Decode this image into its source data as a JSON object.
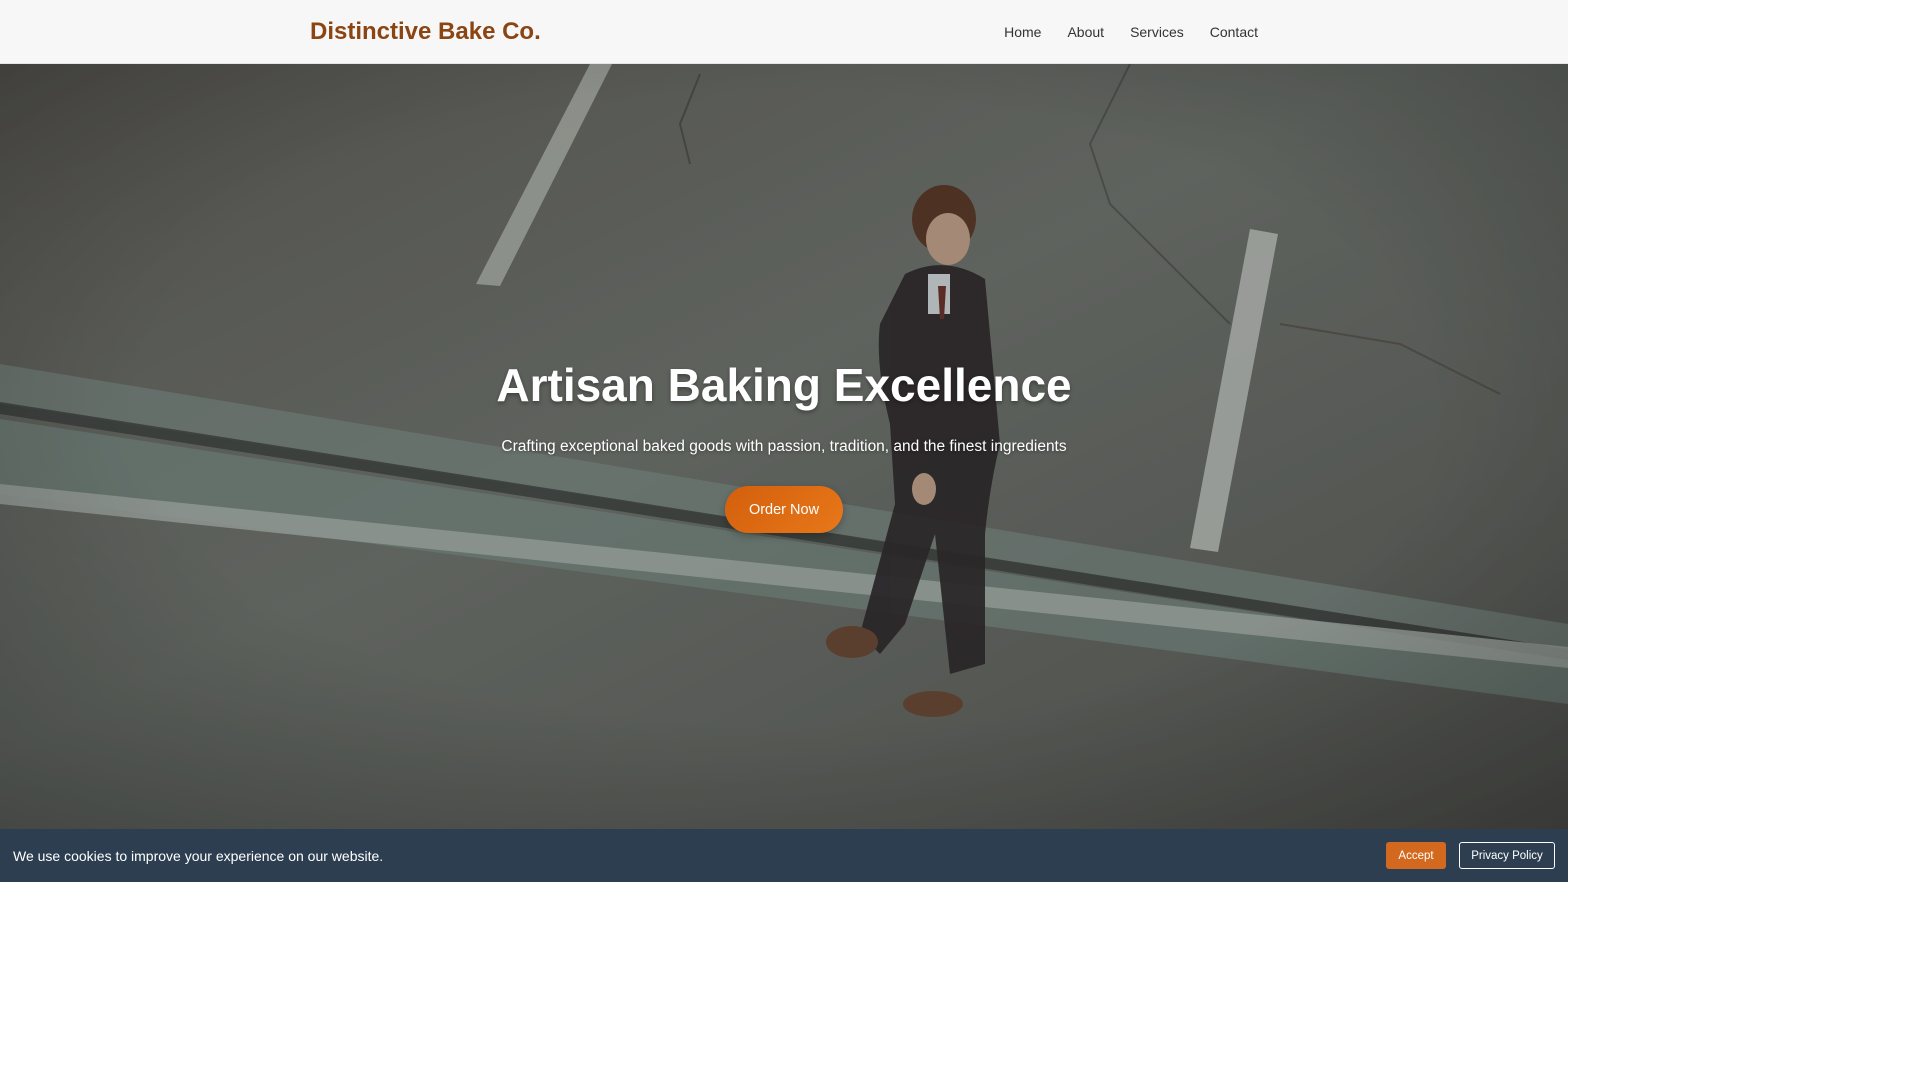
{
  "header": {
    "brand": "Distinctive Bake Co.",
    "nav": [
      {
        "label": "Home"
      },
      {
        "label": "About"
      },
      {
        "label": "Services"
      },
      {
        "label": "Contact"
      }
    ]
  },
  "hero": {
    "title": "Artisan Baking Excellence",
    "subtitle": "Crafting exceptional baked goods with passion, tradition, and the finest ingredients",
    "cta_label": "Order Now",
    "background_description_icon": "photo-person-walking-on-road"
  },
  "cookie_banner": {
    "message": "We use cookies to improve your experience on our website.",
    "accept_label": "Accept",
    "privacy_label": "Privacy Policy"
  },
  "colors": {
    "brand": "#8b4513",
    "accent": "#d2691e",
    "cookie_bg": "#2c3e50"
  }
}
